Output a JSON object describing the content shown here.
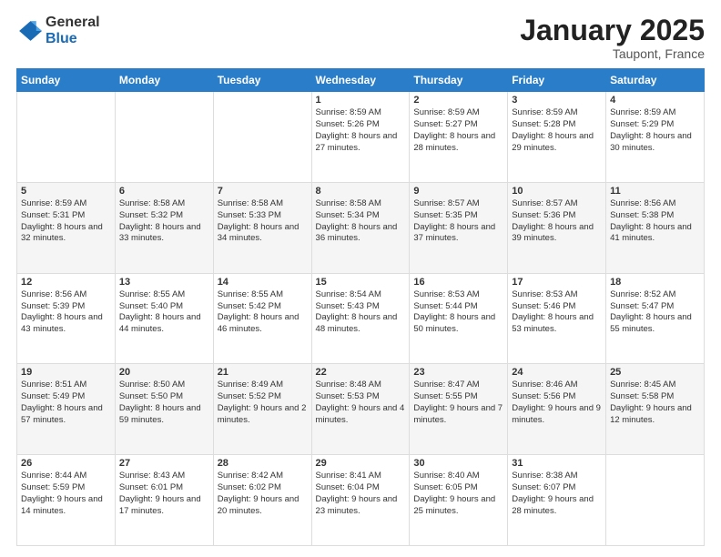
{
  "header": {
    "logo_general": "General",
    "logo_blue": "Blue",
    "month_title": "January 2025",
    "location": "Taupont, France"
  },
  "days_of_week": [
    "Sunday",
    "Monday",
    "Tuesday",
    "Wednesday",
    "Thursday",
    "Friday",
    "Saturday"
  ],
  "weeks": [
    [
      {
        "day": "",
        "info": ""
      },
      {
        "day": "",
        "info": ""
      },
      {
        "day": "",
        "info": ""
      },
      {
        "day": "1",
        "info": "Sunrise: 8:59 AM\nSunset: 5:26 PM\nDaylight: 8 hours and 27 minutes."
      },
      {
        "day": "2",
        "info": "Sunrise: 8:59 AM\nSunset: 5:27 PM\nDaylight: 8 hours and 28 minutes."
      },
      {
        "day": "3",
        "info": "Sunrise: 8:59 AM\nSunset: 5:28 PM\nDaylight: 8 hours and 29 minutes."
      },
      {
        "day": "4",
        "info": "Sunrise: 8:59 AM\nSunset: 5:29 PM\nDaylight: 8 hours and 30 minutes."
      }
    ],
    [
      {
        "day": "5",
        "info": "Sunrise: 8:59 AM\nSunset: 5:31 PM\nDaylight: 8 hours and 32 minutes."
      },
      {
        "day": "6",
        "info": "Sunrise: 8:58 AM\nSunset: 5:32 PM\nDaylight: 8 hours and 33 minutes."
      },
      {
        "day": "7",
        "info": "Sunrise: 8:58 AM\nSunset: 5:33 PM\nDaylight: 8 hours and 34 minutes."
      },
      {
        "day": "8",
        "info": "Sunrise: 8:58 AM\nSunset: 5:34 PM\nDaylight: 8 hours and 36 minutes."
      },
      {
        "day": "9",
        "info": "Sunrise: 8:57 AM\nSunset: 5:35 PM\nDaylight: 8 hours and 37 minutes."
      },
      {
        "day": "10",
        "info": "Sunrise: 8:57 AM\nSunset: 5:36 PM\nDaylight: 8 hours and 39 minutes."
      },
      {
        "day": "11",
        "info": "Sunrise: 8:56 AM\nSunset: 5:38 PM\nDaylight: 8 hours and 41 minutes."
      }
    ],
    [
      {
        "day": "12",
        "info": "Sunrise: 8:56 AM\nSunset: 5:39 PM\nDaylight: 8 hours and 43 minutes."
      },
      {
        "day": "13",
        "info": "Sunrise: 8:55 AM\nSunset: 5:40 PM\nDaylight: 8 hours and 44 minutes."
      },
      {
        "day": "14",
        "info": "Sunrise: 8:55 AM\nSunset: 5:42 PM\nDaylight: 8 hours and 46 minutes."
      },
      {
        "day": "15",
        "info": "Sunrise: 8:54 AM\nSunset: 5:43 PM\nDaylight: 8 hours and 48 minutes."
      },
      {
        "day": "16",
        "info": "Sunrise: 8:53 AM\nSunset: 5:44 PM\nDaylight: 8 hours and 50 minutes."
      },
      {
        "day": "17",
        "info": "Sunrise: 8:53 AM\nSunset: 5:46 PM\nDaylight: 8 hours and 53 minutes."
      },
      {
        "day": "18",
        "info": "Sunrise: 8:52 AM\nSunset: 5:47 PM\nDaylight: 8 hours and 55 minutes."
      }
    ],
    [
      {
        "day": "19",
        "info": "Sunrise: 8:51 AM\nSunset: 5:49 PM\nDaylight: 8 hours and 57 minutes."
      },
      {
        "day": "20",
        "info": "Sunrise: 8:50 AM\nSunset: 5:50 PM\nDaylight: 8 hours and 59 minutes."
      },
      {
        "day": "21",
        "info": "Sunrise: 8:49 AM\nSunset: 5:52 PM\nDaylight: 9 hours and 2 minutes."
      },
      {
        "day": "22",
        "info": "Sunrise: 8:48 AM\nSunset: 5:53 PM\nDaylight: 9 hours and 4 minutes."
      },
      {
        "day": "23",
        "info": "Sunrise: 8:47 AM\nSunset: 5:55 PM\nDaylight: 9 hours and 7 minutes."
      },
      {
        "day": "24",
        "info": "Sunrise: 8:46 AM\nSunset: 5:56 PM\nDaylight: 9 hours and 9 minutes."
      },
      {
        "day": "25",
        "info": "Sunrise: 8:45 AM\nSunset: 5:58 PM\nDaylight: 9 hours and 12 minutes."
      }
    ],
    [
      {
        "day": "26",
        "info": "Sunrise: 8:44 AM\nSunset: 5:59 PM\nDaylight: 9 hours and 14 minutes."
      },
      {
        "day": "27",
        "info": "Sunrise: 8:43 AM\nSunset: 6:01 PM\nDaylight: 9 hours and 17 minutes."
      },
      {
        "day": "28",
        "info": "Sunrise: 8:42 AM\nSunset: 6:02 PM\nDaylight: 9 hours and 20 minutes."
      },
      {
        "day": "29",
        "info": "Sunrise: 8:41 AM\nSunset: 6:04 PM\nDaylight: 9 hours and 23 minutes."
      },
      {
        "day": "30",
        "info": "Sunrise: 8:40 AM\nSunset: 6:05 PM\nDaylight: 9 hours and 25 minutes."
      },
      {
        "day": "31",
        "info": "Sunrise: 8:38 AM\nSunset: 6:07 PM\nDaylight: 9 hours and 28 minutes."
      },
      {
        "day": "",
        "info": ""
      }
    ]
  ]
}
